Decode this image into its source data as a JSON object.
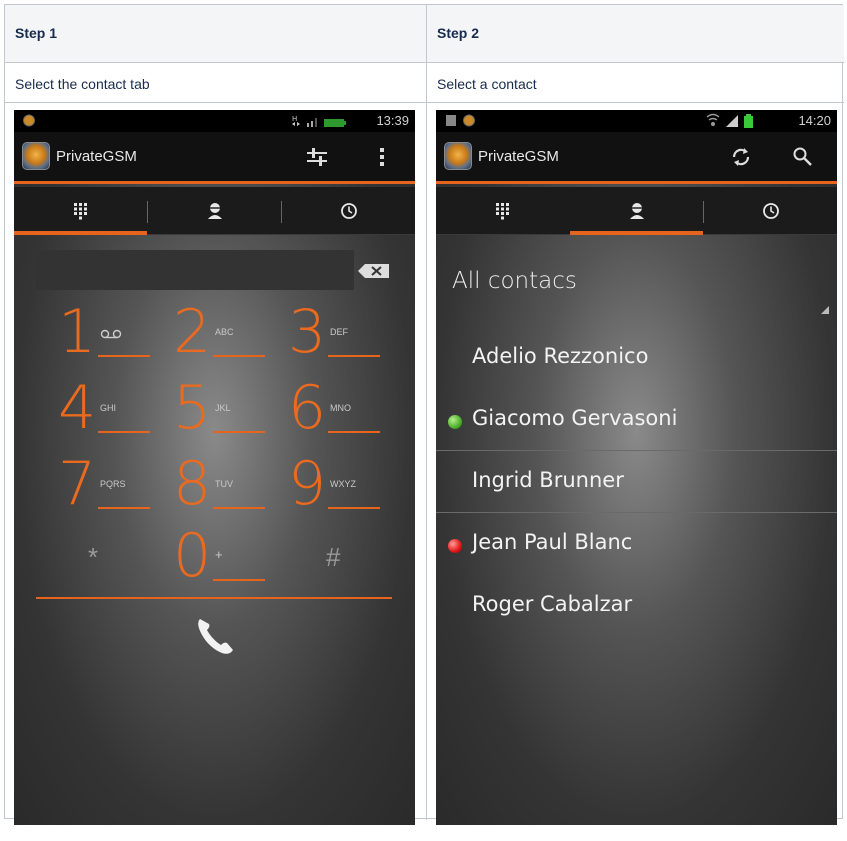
{
  "table": {
    "step1": {
      "header": "Step 1",
      "description": "Select the contact tab"
    },
    "step2": {
      "header": "Step 2",
      "description": "Select a contact"
    }
  },
  "phone1": {
    "status_time": "13:39",
    "app_name": "PrivateGSM",
    "tabs": [
      "dialpad-icon",
      "contacts-icon",
      "history-icon"
    ],
    "selected_tab": 0,
    "keys": [
      {
        "digit": "1",
        "letters": ""
      },
      {
        "digit": "2",
        "letters": "ABC"
      },
      {
        "digit": "3",
        "letters": "DEF"
      },
      {
        "digit": "4",
        "letters": "GHI"
      },
      {
        "digit": "5",
        "letters": "JKL"
      },
      {
        "digit": "6",
        "letters": "MNO"
      },
      {
        "digit": "7",
        "letters": "PQRS"
      },
      {
        "digit": "8",
        "letters": "TUV"
      },
      {
        "digit": "9",
        "letters": "WXYZ"
      },
      {
        "digit": "0",
        "letters": "+"
      }
    ],
    "star": "*",
    "hash": "#"
  },
  "phone2": {
    "status_time": "14:20",
    "app_name": "PrivateGSM",
    "selected_tab": 1,
    "filter_label": "All contacs",
    "contacts": [
      {
        "name": "Adelio Rezzonico",
        "status": "none"
      },
      {
        "name": "Giacomo Gervasoni",
        "status": "online"
      },
      {
        "name": "Ingrid Brunner",
        "status": "none"
      },
      {
        "name": "Jean Paul Blanc",
        "status": "busy"
      },
      {
        "name": "Roger Cabalzar",
        "status": "none"
      }
    ]
  },
  "colors": {
    "accent": "#e5651c",
    "online": "#4caf2a",
    "busy": "#e01515"
  }
}
